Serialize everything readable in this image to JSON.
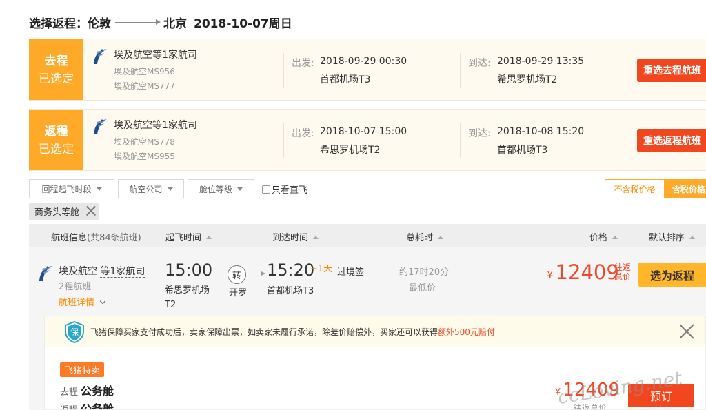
{
  "route": {
    "prefix": "选择返程：",
    "from_city": "伦敦",
    "to_city": "北京",
    "date": "2018-10-07周日"
  },
  "selected": [
    {
      "tag_line1": "去程",
      "tag_line2": "已选定",
      "airline": "埃及航空等1家航司",
      "flight1": "埃及航空MS956",
      "flight2": "埃及航空MS777",
      "dep_label": "出发:",
      "dep_time": "2018-09-29 00:30",
      "dep_airport": "首都机场T3",
      "arr_label": "到达:",
      "arr_time": "2018-09-29 13:35",
      "arr_airport": "希思罗机场T2",
      "button": "重选去程航班"
    },
    {
      "tag_line1": "返程",
      "tag_line2": "已选定",
      "airline": "埃及航空等1家航司",
      "flight1": "埃及航空MS778",
      "flight2": "埃及航空MS955",
      "dep_label": "出发:",
      "dep_time": "2018-10-07 15:00",
      "dep_airport": "希思罗机场T2",
      "arr_label": "到达:",
      "arr_time": "2018-10-08 15:20",
      "arr_airport": "首都机场T3",
      "button": "重选返程航班"
    }
  ],
  "filters": {
    "time": "回程起飞时段",
    "airline": "航空公司",
    "cabin": "舱位等级",
    "direct_only": "只看直飞",
    "tax_excluded": "不含税价格",
    "tax_included": "含税价格"
  },
  "active_chip": "商务头等舱",
  "table_header": {
    "flight_info": "航班信息",
    "flight_count": "(共84条航班)",
    "depart_time": "起飞时间",
    "arrive_time": "到达时间",
    "duration": "总耗时",
    "price": "价格",
    "sort": "默认排序"
  },
  "result": {
    "airline_prefix": "埃及航空 ",
    "airline_more": "等1家航司",
    "legs": "2程航班",
    "detail_link": "航班详情",
    "dep_time": "15:00",
    "dep_airport": "希思罗机场T2",
    "transfer_label": "转",
    "transfer_city": "开罗",
    "arr_time": "15:20",
    "next_day": "+1天",
    "arr_airport": "首都机场T3",
    "visa": "过境签",
    "duration": "约17时20分",
    "lowest": "最低价",
    "currency": "¥",
    "price": "12409",
    "price_note": "往返总价",
    "choose_button": "选为返程"
  },
  "promo": {
    "guarantee_icon_text": "保",
    "text": "飞猪保障买家支付成功后，卖家保障出票，如卖家未履行承诺，除差价赔偿外，买家还可以获得",
    "highlight": "额外500元赔付",
    "badge": "飞猪特卖",
    "outbound_label": "去程",
    "outbound_cabin": "公务舱",
    "return_label": "返程",
    "return_cabin": "公务舱",
    "currency": "¥",
    "price": "12409",
    "total_label": "往返总价",
    "book_button": "预订"
  },
  "watermark": "ccLoving.net",
  "colors": {
    "accent_orange": "#ffa928",
    "alert_red": "#f2461f",
    "price_red": "#f0492a"
  }
}
